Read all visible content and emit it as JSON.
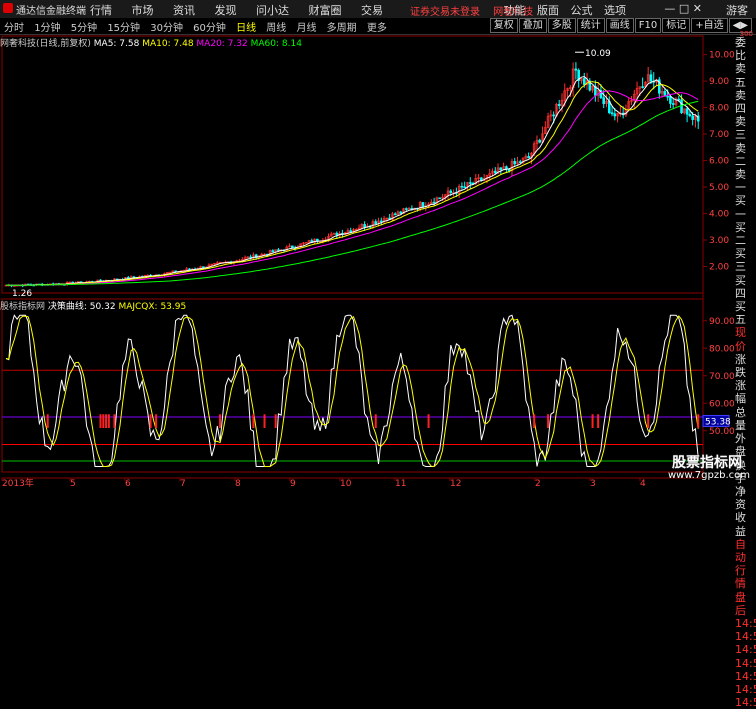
{
  "menubar": {
    "app_name": "通达信金融终端",
    "menus": [
      "行情",
      "市场",
      "资讯",
      "发现",
      "问小达",
      "财富圈",
      "交易"
    ],
    "status": [
      "证券交易未登录",
      "网奢科技"
    ],
    "right": [
      "功能",
      "版面",
      "公式",
      "选项"
    ],
    "guest": "游客",
    "window_controls": "—  □  ✕"
  },
  "periods": [
    "分时",
    "1分钟",
    "5分钟",
    "15分钟",
    "30分钟",
    "60分钟",
    "日线",
    "周线",
    "月线",
    "多周期",
    "更多"
  ],
  "active_period": "日线",
  "tools": [
    "复权",
    "叠加",
    "多股",
    "统计",
    "画线",
    "F10",
    "标记",
    "+自选",
    "◀▶"
  ],
  "stock_info": {
    "name": "网奢科技(日线,前复权)",
    "ma5": "MA5: 7.58",
    "ma10": "MA10: 7.48",
    "ma20": "MA20: 7.32",
    "ma60": "MA60: 8.14"
  },
  "indicator_info": {
    "name": "股标指标网",
    "v1": "决策曲线: 50.32",
    "v2": "MAJCQX: 53.95"
  },
  "price_axis": [
    "10.00",
    "9.00",
    "8.00",
    "7.00",
    "6.00",
    "5.00",
    "4.00",
    "3.00",
    "2.00"
  ],
  "ind_axis": [
    "90.00",
    "80.00",
    "70.00",
    "60.00",
    "50.00"
  ],
  "ind_current": "53.38",
  "high_label": "10.09",
  "low_label": "1.26",
  "x_axis": [
    "2013年",
    "5",
    "6",
    "7",
    "8",
    "9",
    "10",
    "11",
    "12",
    "2",
    "3",
    "4"
  ],
  "sidebar": [
    "委比",
    "卖五",
    "卖四",
    "卖三",
    "卖二",
    "卖一",
    "买一",
    "买二",
    "买三",
    "买四",
    "买五",
    "现价",
    "涨跌",
    "涨幅",
    "总量",
    "外盘",
    "换手",
    "净资",
    "收益",
    "自动",
    "行情",
    "盘后",
    "14:5",
    "14:5",
    "14:5",
    "14:5",
    "14:5",
    "14:5",
    "14:5"
  ],
  "corner": "300",
  "watermark": "股票指标网",
  "watermark_url": "www.7gpzb.com",
  "colors": {
    "up": "#ff3030",
    "down": "#00ffff",
    "ma5": "#ffffff",
    "ma10": "#ffff00",
    "ma20": "#ff00ff",
    "ma60": "#00ff00"
  }
}
